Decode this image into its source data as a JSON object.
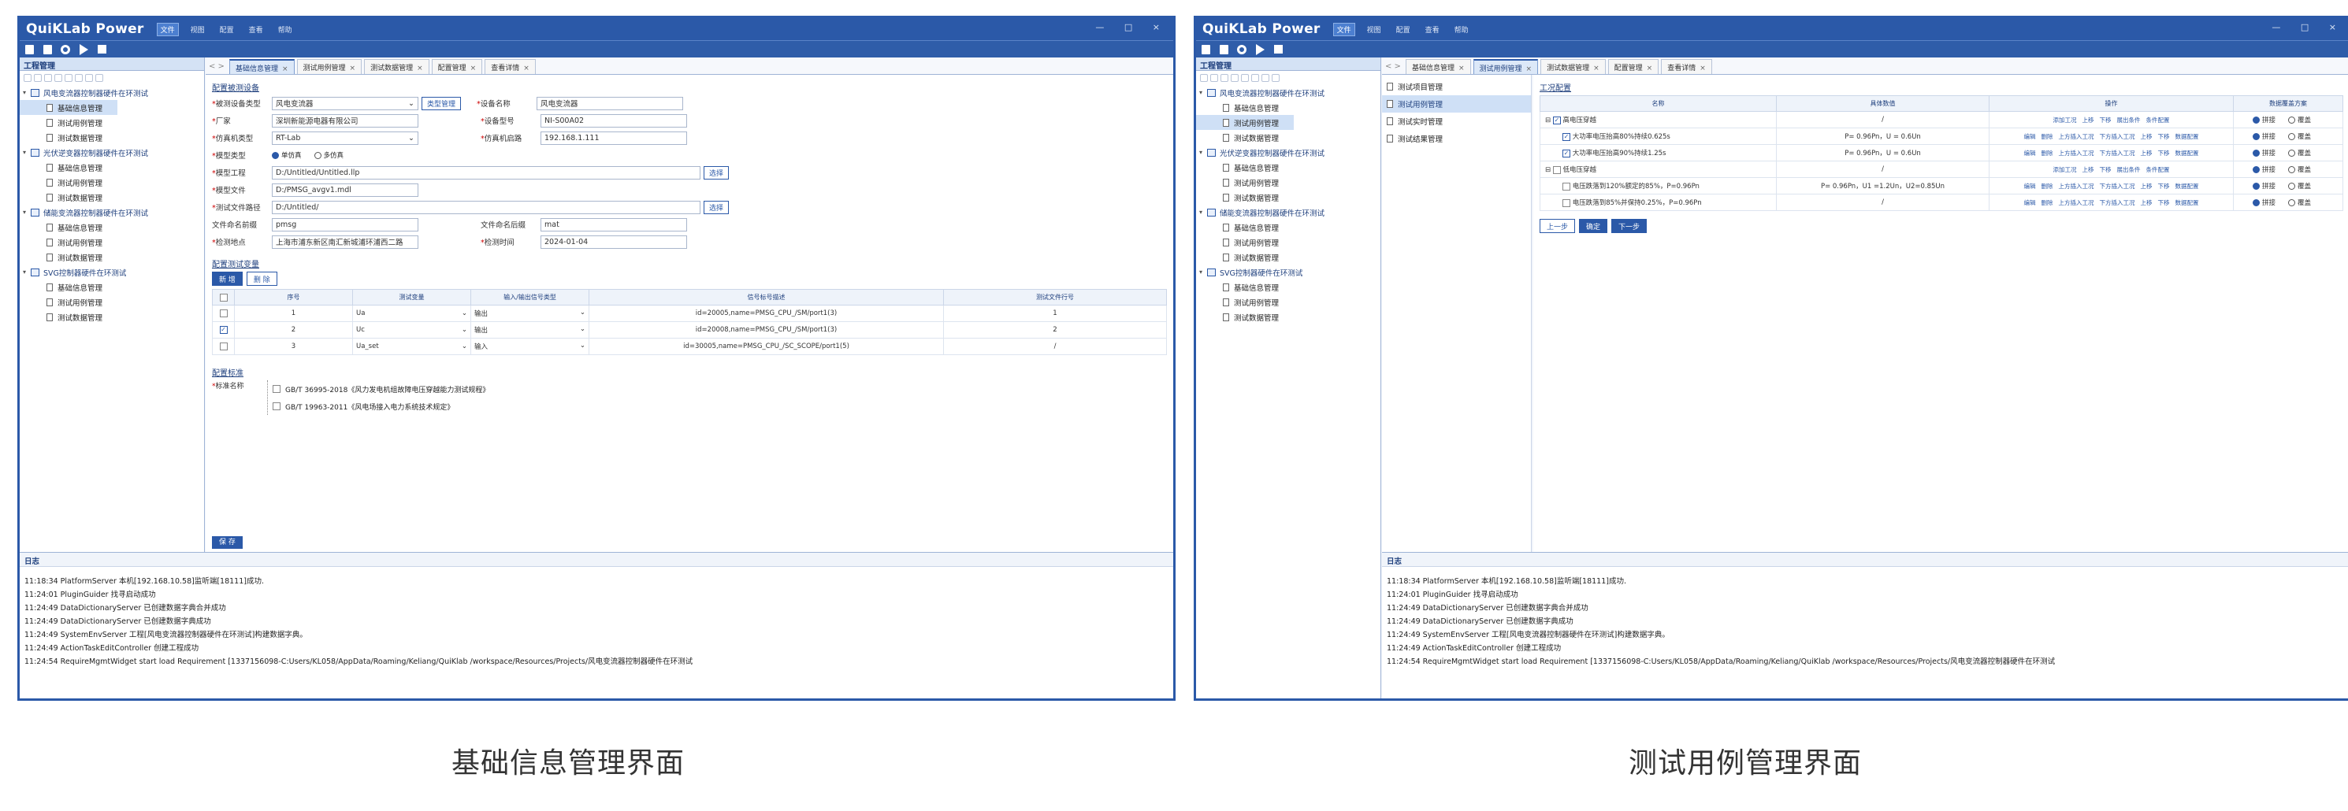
{
  "app": {
    "title": "QuiKLab Power",
    "menu": [
      "文件",
      "视图",
      "配置",
      "查看",
      "帮助"
    ],
    "window_controls": "— □ ×",
    "colors": {
      "brand": "#2b59a8",
      "accent": "#4c7fd0"
    }
  },
  "sidebar": {
    "header": "工程管理",
    "tree": [
      {
        "label": "风电变流器控制器硬件在环测试",
        "children": [
          "基础信息管理",
          "测试用例管理",
          "测试数据管理"
        ]
      },
      {
        "label": "光伏逆变器控制器硬件在环测试",
        "children": [
          "基础信息管理",
          "测试用例管理",
          "测试数据管理"
        ]
      },
      {
        "label": "储能变流器控制器硬件在环测试",
        "children": [
          "基础信息管理",
          "测试用例管理",
          "测试数据管理"
        ]
      },
      {
        "label": "SVG控制器硬件在环测试",
        "children": [
          "基础信息管理",
          "测试用例管理",
          "测试数据管理"
        ]
      }
    ]
  },
  "tabs": [
    "基础信息管理",
    "测试用例管理",
    "测试数据管理",
    "配置管理",
    "查看详情"
  ],
  "basic": {
    "section1": "配置被测设备",
    "row1": {
      "l1": "被测设备类型",
      "v1": "风电变流器",
      "btn": "类型管理",
      "l2": "设备名称",
      "v2": "风电变流器"
    },
    "row2": {
      "l1": "厂家",
      "v1": "深圳新能源电器有限公司",
      "l2": "设备型号",
      "v2": "NI-S00A02"
    },
    "row3": {
      "l1": "仿真机类型",
      "v1": "RT-Lab",
      "l2": "仿真机启路",
      "v2": "192.168.1.111"
    },
    "row4": {
      "l1": "模型类型",
      "r1": "单仿真",
      "r2": "多仿真"
    },
    "row5": {
      "l1": "模型工程",
      "v1": "D:/Untitled/Untitled.llp",
      "btn": "选择"
    },
    "row6": {
      "l1": "模型文件",
      "v1": "D:/PMSG_avgv1.mdl"
    },
    "row7": {
      "l1": "测试文件路径",
      "v1": "D:/Untitled/",
      "btn": "选择"
    },
    "row8": {
      "l1": "文件命名前缀",
      "v1": "pmsg",
      "l2": "文件命名后缀",
      "v2": "mat"
    },
    "row9": {
      "l1": "检测地点",
      "v1": "上海市浦东新区南汇新城浦环浦西二路",
      "l2": "检测时间",
      "v2": "2024-01-04"
    },
    "section2": "配置测试变量",
    "add_btn": "新 增",
    "del_btn": "删 除",
    "var_headers": [
      "序号",
      "测试变量",
      "输入/输出信号类型",
      "信号标号描述",
      "测试文件行号"
    ],
    "var_rows": [
      {
        "no": "1",
        "var": "Ua",
        "io": "输出",
        "desc": "id=20005,name=PMSG_CPU_/SM/port1(3)",
        "line": "1",
        "checked": false
      },
      {
        "no": "2",
        "var": "Uc",
        "io": "输出",
        "desc": "id=20008,name=PMSG_CPU_/SM/port1(3)",
        "line": "2",
        "checked": true
      },
      {
        "no": "3",
        "var": "Ua_set",
        "io": "输入",
        "desc": "id=30005,name=PMSG_CPU_/SC_SCOPE/port1(5)",
        "line": "/",
        "checked": false
      }
    ],
    "section3": "配置标准",
    "std_label": "标准名称",
    "standards": [
      "GB/T 36995-2018《风力发电机组故障电压穿越能力测试规程》",
      "GB/T 19963-2011《风电场接入电力系统技术规定》"
    ],
    "save_btn": "保 存"
  },
  "log": {
    "header": "日志",
    "lines": [
      "11:18:34 PlatformServer 本机[192.168.10.58]监听端[18111]成功.",
      "11:24:01 PluginGuider 找寻启动成功",
      "11:24:49 DataDictionaryServer 已创建数据字典合并成功",
      "11:24:49 DataDictionaryServer 已创建数据字典成功",
      "11:24:49 SystemEnvServer 工程[风电变流器控制器硬件在环测试]构建数据字典。",
      "11:24:49 ActionTaskEditController 创建工程成功",
      "11:24:54 RequireMgmtWidget start load Requirement [1337156098-C:Users/KL058/AppData/Roaming/Keliang/QuiKlab /workspace/Resources/Projects/风电变流器控制器硬件在环测试"
    ]
  },
  "testcase": {
    "subnav": [
      "测试项目管理",
      "测试用例管理",
      "测试实时管理",
      "测试结果管理"
    ],
    "section": "工况配置",
    "headers": [
      "名称",
      "具体数值",
      "操作",
      "数据覆盖方案"
    ],
    "rows": [
      {
        "level": 1,
        "name": "高电压穿越",
        "value": "/",
        "ops": [
          "添加工况",
          "上移",
          "下移",
          "展出条件",
          "条件配置"
        ],
        "opt1": "拼接",
        "opt2": "覆盖"
      },
      {
        "level": 2,
        "name": "大功率电压抬高80%持续0.625s",
        "value": "P= 0.96Pn，U = 0.6Un",
        "ops": [
          "编辑",
          "删除",
          "上方插入工况",
          "下方插入工况",
          "上移",
          "下移",
          "数据配置"
        ],
        "opt1": "拼接",
        "opt2": "覆盖"
      },
      {
        "level": 2,
        "name": "大功率电压抬高90%持续1.25s",
        "value": "P= 0.96Pn，U = 0.6Un",
        "ops": [
          "编辑",
          "删除",
          "上方插入工况",
          "下方插入工况",
          "上移",
          "下移",
          "数据配置"
        ],
        "opt1": "拼接",
        "opt2": "覆盖"
      },
      {
        "level": 1,
        "name": "低电压穿越",
        "value": "/",
        "ops": [
          "添加工况",
          "上移",
          "下移",
          "展出条件",
          "条件配置"
        ],
        "opt1": "拼接",
        "opt2": "覆盖"
      },
      {
        "level": 2,
        "name": "电压跌落到120%额定的85%，P=0.96Pn",
        "value": "P= 0.96Pn，U1 =1.2Un，U2=0.85Un",
        "ops": [
          "编辑",
          "删除",
          "上方插入工况",
          "下方插入工况",
          "上移",
          "下移",
          "数据配置"
        ],
        "opt1": "拼接",
        "opt2": "覆盖"
      },
      {
        "level": 2,
        "name": "电压跌落到85%并保持0.25%，P=0.96Pn",
        "value": "/",
        "ops": [
          "编辑",
          "删除",
          "上方插入工况",
          "下方插入工况",
          "上移",
          "下移",
          "数据配置"
        ],
        "opt1": "拼接",
        "opt2": "覆盖"
      }
    ],
    "prev_btn": "上一步",
    "save_btn": "确定",
    "next_btn": "下一步"
  },
  "captions": {
    "left": "基础信息管理界面",
    "right": "测试用例管理界面"
  }
}
